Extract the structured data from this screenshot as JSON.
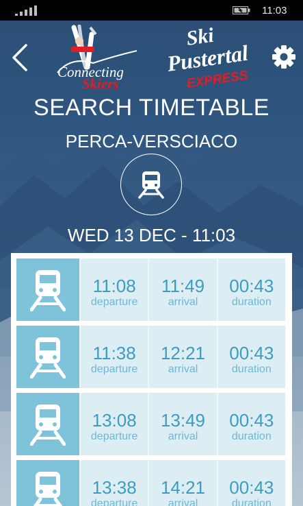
{
  "status_bar": {
    "time": "11:03"
  },
  "header": {
    "logo_left_text": "Connecting Skiers",
    "logo_right_text": "Ski Pustertal Express"
  },
  "page": {
    "title": "SEARCH TIMETABLE",
    "station": "PERCA-VERSCIACO",
    "datetime": "WED 13 DEC - 11:03"
  },
  "connections": [
    {
      "departure": "11:08",
      "arrival": "11:49",
      "duration": "00:43"
    },
    {
      "departure": "11:38",
      "arrival": "12:21",
      "duration": "00:43"
    },
    {
      "departure": "13:08",
      "arrival": "13:49",
      "duration": "00:43"
    },
    {
      "departure": "13:38",
      "arrival": "14:21",
      "duration": "00:43"
    }
  ],
  "labels": {
    "departure": "departure",
    "arrival": "arrival",
    "duration": "duration"
  },
  "colors": {
    "accent": "#3d9cc0",
    "train_tile": "#7ec3da",
    "cell_bg": "#dcedf4"
  }
}
